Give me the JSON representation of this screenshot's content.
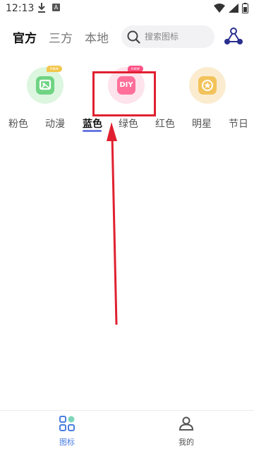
{
  "status_bar": {
    "time": "12:13",
    "notification_icon": "download-icon",
    "app_badge": "A"
  },
  "header": {
    "tabs": [
      {
        "label": "官方",
        "active": true
      },
      {
        "label": "三方",
        "active": false
      },
      {
        "label": "本地",
        "active": false
      }
    ],
    "search": {
      "placeholder": "搜索图标",
      "icon": "search-icon"
    },
    "share_icon": "share-icon"
  },
  "categories": {
    "icons": [
      {
        "name": "new-icon-green",
        "badge": "new",
        "color": "#7ad98a"
      },
      {
        "name": "diy-icon",
        "badge": "new",
        "color": "#ff6f9a",
        "text": "DIY"
      },
      {
        "name": "star-icon",
        "color": "#f2c766"
      }
    ],
    "tabs": [
      {
        "label": "粉色",
        "active": false
      },
      {
        "label": "动漫",
        "active": false
      },
      {
        "label": "蓝色",
        "active": true
      },
      {
        "label": "绿色",
        "active": false
      },
      {
        "label": "红色",
        "active": false
      },
      {
        "label": "明星",
        "active": false
      },
      {
        "label": "节日",
        "active": false
      }
    ],
    "active_underline_color": "#6878e0"
  },
  "annotation": {
    "box_color": "#e02030",
    "arrow_color": "#e02030"
  },
  "bottom_nav": {
    "items": [
      {
        "label": "图标",
        "active": true,
        "icon": "grid-icon",
        "color": "#4a7de0"
      },
      {
        "label": "我的",
        "active": false,
        "icon": "user-icon",
        "color": "#555555"
      }
    ]
  }
}
